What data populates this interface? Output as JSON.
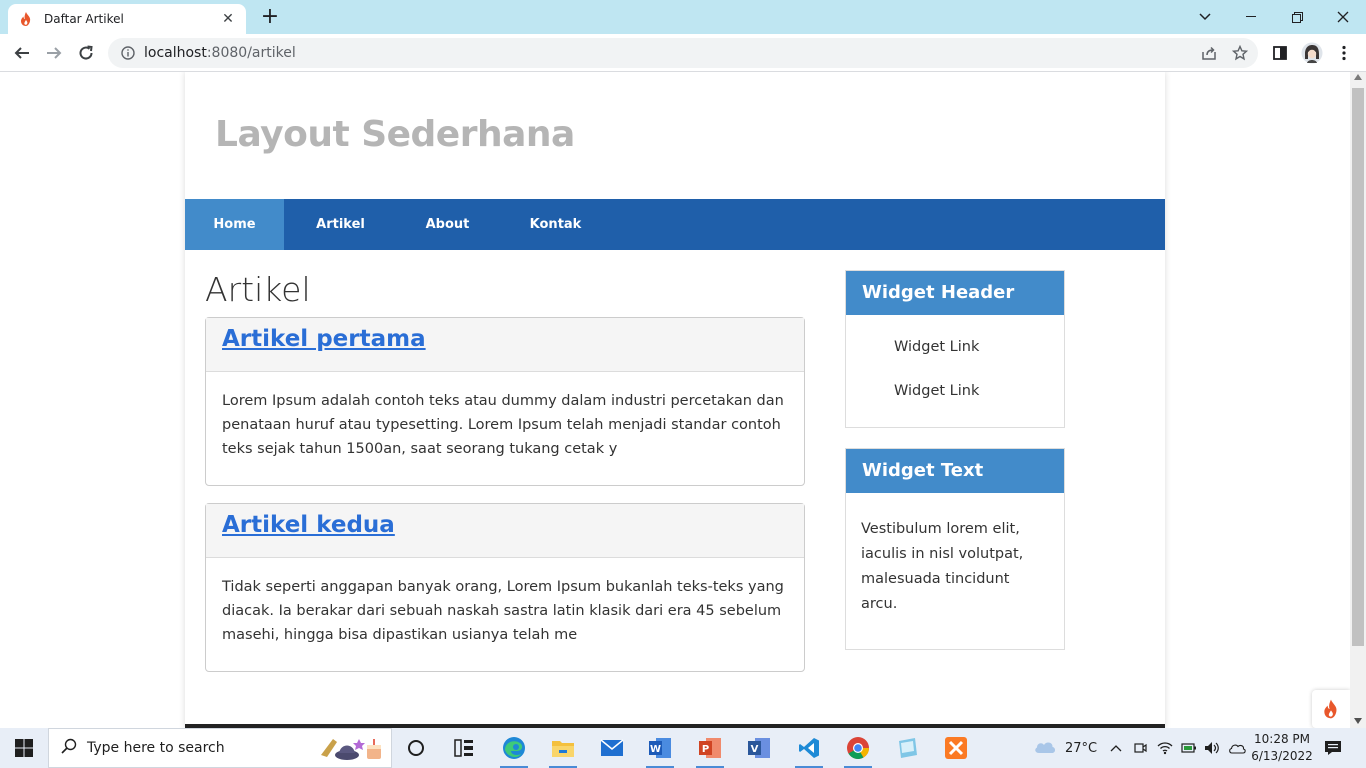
{
  "browser": {
    "tab_title": "Daftar Artikel",
    "url_host": "localhost",
    "url_rest": ":8080/artikel"
  },
  "site": {
    "title": "Layout Sederhana",
    "nav": [
      "Home",
      "Artikel",
      "About",
      "Kontak"
    ],
    "active_nav": "Home"
  },
  "main": {
    "heading": "Artikel",
    "articles": [
      {
        "title": "Artikel pertama",
        "body": "Lorem Ipsum adalah contoh teks atau dummy dalam industri percetakan dan penataan huruf atau typesetting. Lorem Ipsum telah menjadi standar contoh teks sejak tahun 1500an, saat seorang tukang cetak y"
      },
      {
        "title": "Artikel kedua",
        "body": "Tidak seperti anggapan banyak orang, Lorem Ipsum bukanlah teks-teks yang diacak. Ia berakar dari sebuah naskah sastra latin klasik dari era 45 sebelum masehi, hingga bisa dipastikan usianya telah me"
      }
    ]
  },
  "sidebar": {
    "widget1": {
      "header": "Widget Header",
      "links": [
        "Widget Link",
        "Widget Link"
      ]
    },
    "widget2": {
      "header": "Widget Text",
      "text": "Vestibulum lorem elit, iaculis in nisl volutpat, malesuada tincidunt arcu."
    }
  },
  "taskbar": {
    "search_placeholder": "Type here to search",
    "temperature": "27°C",
    "time": "10:28 PM",
    "date": "6/13/2022"
  },
  "colors": {
    "nav_bg": "#1f5faa",
    "nav_active": "#428bca",
    "widget_header": "#428bca",
    "link": "#2a6ed6",
    "site_title": "#b5b5b5"
  }
}
